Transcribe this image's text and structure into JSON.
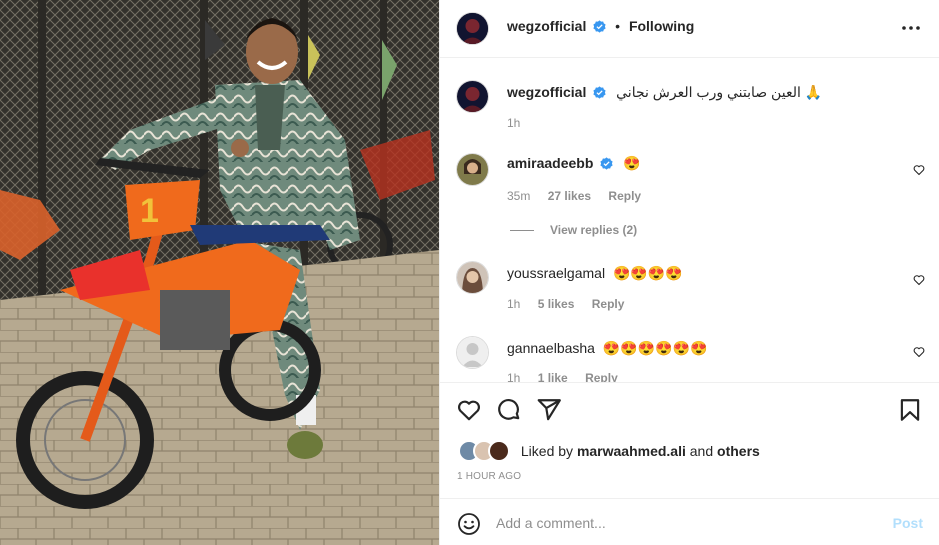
{
  "post": {
    "author": "wegzofficial",
    "follow_status": "Following",
    "separator": "•"
  },
  "caption": {
    "username": "wegzofficial",
    "text": "العين صابتني ورب العرش نجاني 🙏",
    "time": "1h"
  },
  "comments": [
    {
      "username": "amiraadeebb",
      "verified": true,
      "text": "😍",
      "time": "35m",
      "likes": "27 likes",
      "reply": "Reply",
      "view_replies": "View replies (2)"
    },
    {
      "username": "youssraelgamal",
      "verified": false,
      "text": "😍😍😍😍",
      "time": "1h",
      "likes": "5 likes",
      "reply": "Reply"
    },
    {
      "username": "gannaelbasha",
      "verified": false,
      "text": "😍😍😍😍😍😍",
      "time": "1h",
      "likes": "1 like",
      "reply": "Reply"
    }
  ],
  "likes": {
    "prefix": "Liked by",
    "user": "marwaahmed.ali",
    "and": "and",
    "others": "others"
  },
  "timestamp": "1 HOUR AGO",
  "add_comment": {
    "placeholder": "Add a comment...",
    "post_label": "Post"
  },
  "icons": {
    "header_more": "more-horizontal-icon",
    "verified": "verified-badge-icon",
    "like": "heart-icon",
    "comment": "comment-icon",
    "share": "share-icon",
    "save": "bookmark-icon",
    "emoji": "emoji-icon"
  },
  "colors": {
    "verified_blue": "#3897f0",
    "post_disabled": "#b2dffc",
    "muted": "#8e8e8e",
    "text": "#262626"
  }
}
